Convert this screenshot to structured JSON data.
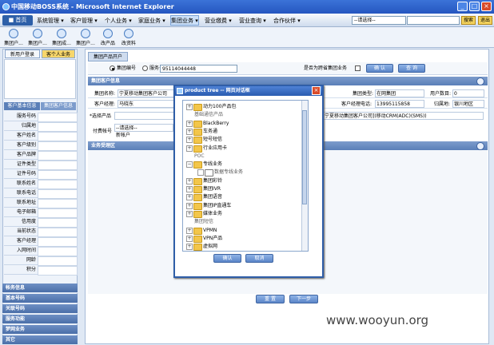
{
  "window": {
    "title": "中国移动BOSS系统 - Microsoft Internet Explorer"
  },
  "menubar": {
    "home": "■ 首页",
    "items": [
      "系统管理 ▾",
      "客户管理 ▾",
      "个人业务 ▾",
      "家庭业务 ▾",
      "集团业务 ▾",
      "营业缴费 ▾",
      "营业查询 ▾",
      "合作伙伴 ▾"
    ],
    "search_select": "--请选择--",
    "search_button": "搜索",
    "exit_button": "退出"
  },
  "toolbar": {
    "items": [
      "集团户...",
      "集团户...",
      "集团成...",
      "集团户...",
      "改产品",
      "改资料"
    ]
  },
  "left": {
    "tabs": [
      "新用户登录",
      "客个人业务"
    ],
    "section_tabs": [
      "客户基本信息",
      "集团客户信息"
    ],
    "rows": [
      "服务号码",
      "归属地",
      "客户姓名",
      "客户级别",
      "客户品牌",
      "证件类型",
      "证件号码",
      "联系姓名",
      "联系电话",
      "联系地址",
      "电子邮箱",
      "信用度",
      "当前状态",
      "客户经理",
      "入网时间",
      "网龄",
      "积分"
    ],
    "nav": [
      "帐务信息",
      "基本号码",
      "关联号码",
      "服务功能",
      "梦网业务",
      "其它"
    ]
  },
  "main": {
    "tab": "集团产品开户",
    "radio_group": "集团编号",
    "radio_service": "服务号码",
    "group_number": "95114044448",
    "cross_label": "是否为跨省集团业务",
    "confirm_button": "确 认",
    "query_button": "查 询",
    "section_info": "集团客户信息",
    "row1": {
      "name_label": "集团名称:",
      "name_value": "宁夏移动集团客户公司",
      "type_label": "集团类型:",
      "type_value": "在网集团",
      "users_label": "用户数目:",
      "users_value": "0"
    },
    "row2": {
      "mgr_label": "客户经理:",
      "mgr_value": "马晓东",
      "phone_label": "客户经理电话:",
      "phone_value": "13995115858",
      "area_label": "归属地:",
      "area_value": "银川地区"
    },
    "product_label": "*选择产品",
    "product_value": "宁夏移动集团客户公司](移动CRM(ADC)(SMS))",
    "pay_label": "付费帐号",
    "pay_select": "--请选择--",
    "pay_new": "新帐户",
    "section_accept": "业务受理区",
    "reset_button": "重 置",
    "next_button": "下一步"
  },
  "dialog": {
    "title": "product tree -- 网页对话框",
    "close": "×",
    "nodes": [
      {
        "label": "动力100产品包",
        "kind": "folder"
      },
      {
        "label": "基础通信产品",
        "kind": "cat"
      },
      {
        "label": "BlackBerry",
        "kind": "folder"
      },
      {
        "label": "车务通",
        "kind": "folder"
      },
      {
        "label": "短号短信",
        "kind": "folder"
      },
      {
        "label": "行业应用卡",
        "kind": "folder"
      },
      {
        "label": "POC",
        "kind": "cat"
      },
      {
        "label": "专线业务",
        "kind": "folder-open"
      },
      {
        "label": "数据专线业务",
        "kind": "child"
      },
      {
        "label": "集团彩铃",
        "kind": "folder"
      },
      {
        "label": "集团IVR",
        "kind": "folder"
      },
      {
        "label": "集团语音",
        "kind": "folder"
      },
      {
        "label": "集团IP直通车",
        "kind": "folder"
      },
      {
        "label": "媒体业务",
        "kind": "folder"
      },
      {
        "label": "集团短信",
        "kind": "cat"
      },
      {
        "label": "VPMN",
        "kind": "folder"
      },
      {
        "label": "VPN产品",
        "kind": "folder"
      },
      {
        "label": "虚拟网",
        "kind": "folder"
      }
    ],
    "ok": "确认",
    "cancel": "取消"
  },
  "watermark": "www.wooyun.org"
}
